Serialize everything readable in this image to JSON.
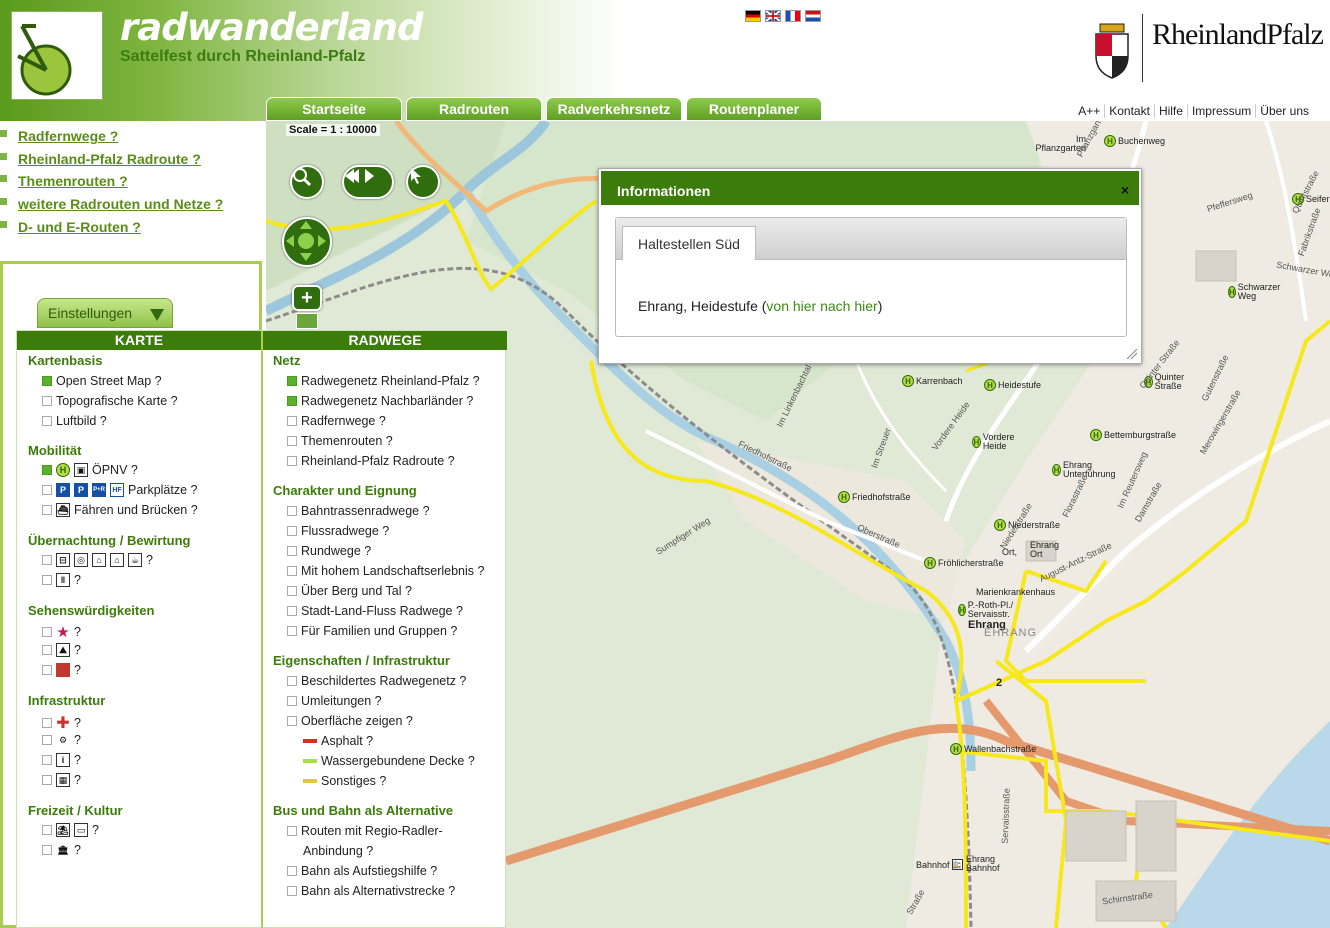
{
  "header": {
    "brand_title": "radwanderland",
    "brand_subtitle": "Sattelfest durch Rheinland-Pfalz",
    "rlp_logo_text": "RheinlandPfalz",
    "flags": [
      "de",
      "gb",
      "fr",
      "nl"
    ]
  },
  "tabs": [
    "Startseite",
    "Radrouten",
    "Radverkehrsnetz",
    "Routenplaner"
  ],
  "toplinks": [
    "A++",
    "Kontakt",
    "Hilfe",
    "Impressum",
    "Über uns"
  ],
  "leftlinks": [
    "Radfernwege ?",
    "Rheinland-Pfalz Radroute ?",
    "Themenrouten ?",
    "weitere Radrouten und Netze ?",
    "D- und E-Routen ?"
  ],
  "settings_label": "Einstellungen",
  "map": {
    "scale": "Scale = 1 : 10000",
    "stops": [
      "Buchenweg",
      "Seifer",
      "Karrenbach",
      "Heidestufe",
      "Quinter Straße",
      "Vordere Heide",
      "Bettemburgstraße",
      "Ehrang Unterführung",
      "Friedhofstraße",
      "Niederstraße",
      "Ehrang Ort",
      "Fröhlicherstraße",
      "Marienkrankenhaus",
      "P.-Roth-Pl./ Servaisstr.",
      "Wallenbachstraße",
      "Schwarzer Weg",
      "Bahnhof",
      "Ehrang Bahnhof"
    ],
    "places": [
      "Im Pflanzgarten",
      "Ehrang",
      "EHRANG",
      "Ort,"
    ],
    "streets": [
      "Friedhofstraße",
      "Oberstraße",
      "Sumpfiger Weg",
      "Im Linkenbachtal",
      "Im Streuer",
      "Vordere Heide",
      "Quinter Straße",
      "Gutenstraße",
      "Merowingerstraße",
      "Im Reutersweg",
      "Damstraße",
      "Florastraße",
      "Schwarzer Weg",
      "Servaisstraße",
      "Schirnstraße",
      "Straße",
      "Pfeffersweg",
      "Pflanzgarten",
      "Fabrikstraße",
      "Quintstraße",
      "Niederstraße",
      "August-Antz-Straße"
    ],
    "route_number": "2"
  },
  "info": {
    "title": "Informationen",
    "close": "×",
    "tab": "Haltestellen Süd",
    "stop_name": "Ehrang, Heidestufe (",
    "link": "von hier nach hier",
    "suffix": ")"
  },
  "karte": {
    "header": "KARTE",
    "kartenbasis": {
      "title": "Kartenbasis",
      "items": [
        "Open Street Map ?",
        "Topografische Karte ?",
        "Luftbild ?"
      ]
    },
    "mobilitaet": {
      "title": "Mobilität",
      "oepnv": "ÖPNV ?",
      "park": "Parkplätze ?",
      "faehren": "Fähren und Brücken ?",
      "park_icons": [
        "P",
        "P",
        "P+R",
        "HF"
      ]
    },
    "uebernachtung": {
      "title": "Übernachtung / Bewirtung",
      "q": "?"
    },
    "sehens": {
      "title": "Sehenswürdigkeiten",
      "q": "?"
    },
    "infra": {
      "title": "Infrastruktur",
      "q": "?"
    },
    "freizeit": {
      "title": "Freizeit / Kultur",
      "q": "?"
    }
  },
  "radwege": {
    "header": "RADWEGE",
    "netz": {
      "title": "Netz",
      "items": [
        "Radwegenetz Rheinland-Pfalz ?",
        "Radwegenetz Nachbarländer ?",
        "Radfernwege ?",
        "Themenrouten ?",
        "Rheinland-Pfalz Radroute ?"
      ]
    },
    "charakter": {
      "title": "Charakter und Eignung",
      "items": [
        "Bahntrassenradwege ?",
        "Flussradwege ?",
        "Rundwege ?",
        "Mit hohem Landschaftserlebnis ?",
        "Über Berg und Tal ?",
        "Stadt-Land-Fluss Radwege ?",
        "Für Familien und Gruppen ?"
      ]
    },
    "eigenschaften": {
      "title": "Eigenschaften / Infrastruktur",
      "items": [
        "Beschildertes Radwegenetz ?",
        "Umleitungen ?",
        "Oberfläche zeigen ?"
      ],
      "surfaces": [
        "Asphalt ?",
        "Wassergebundene Decke ?",
        "Sonstiges ?"
      ]
    },
    "bus": {
      "title": "Bus und Bahn als Alternative",
      "items": [
        "Routen mit Regio-Radler-",
        "Anbindung ?",
        "Bahn als Aufstiegshilfe ?",
        "Bahn als Alternativstrecke ?"
      ]
    }
  },
  "colors": {
    "brand_green": "#3c7c0a",
    "route_yellow": "#f6e81a",
    "asphalt": "#d8311c",
    "wasser": "#a7e23a",
    "sonstiges": "#e2c64a"
  }
}
